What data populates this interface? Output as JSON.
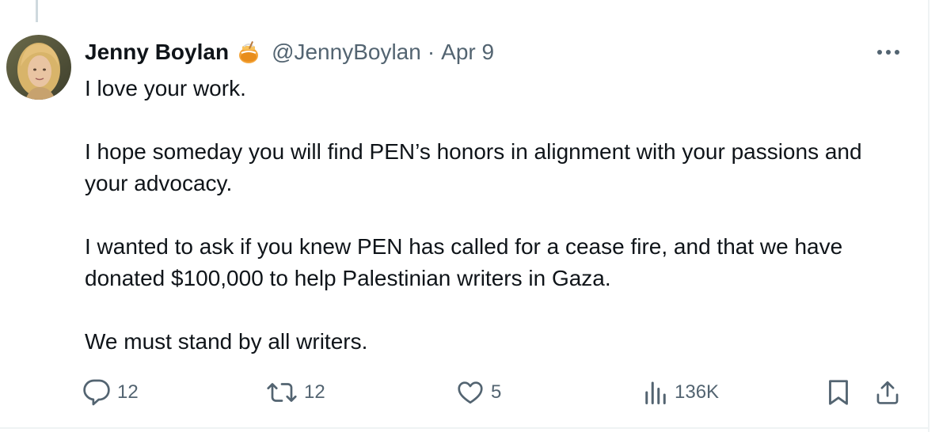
{
  "tweet": {
    "author_name": "Jenny Boylan",
    "author_badge_icon": "honey-pot-emoji",
    "author_handle": "@JennyBoylan",
    "separator": "·",
    "date": "Apr 9",
    "paragraphs": [
      "I love your work.",
      "I hope someday you will find PEN’s honors in alignment with your passions and your advocacy.",
      "I wanted to ask if you knew PEN has called for a cease fire, and that we have donated $100,000 to help Palestinian writers in Gaza.",
      "We must stand by all writers."
    ]
  },
  "actions": {
    "replies": "12",
    "reposts": "12",
    "likes": "5",
    "views": "136K"
  },
  "colors": {
    "text": "#0f1419",
    "secondary": "#536471",
    "border": "#eff3f4",
    "thread_line": "#cfd9de"
  }
}
